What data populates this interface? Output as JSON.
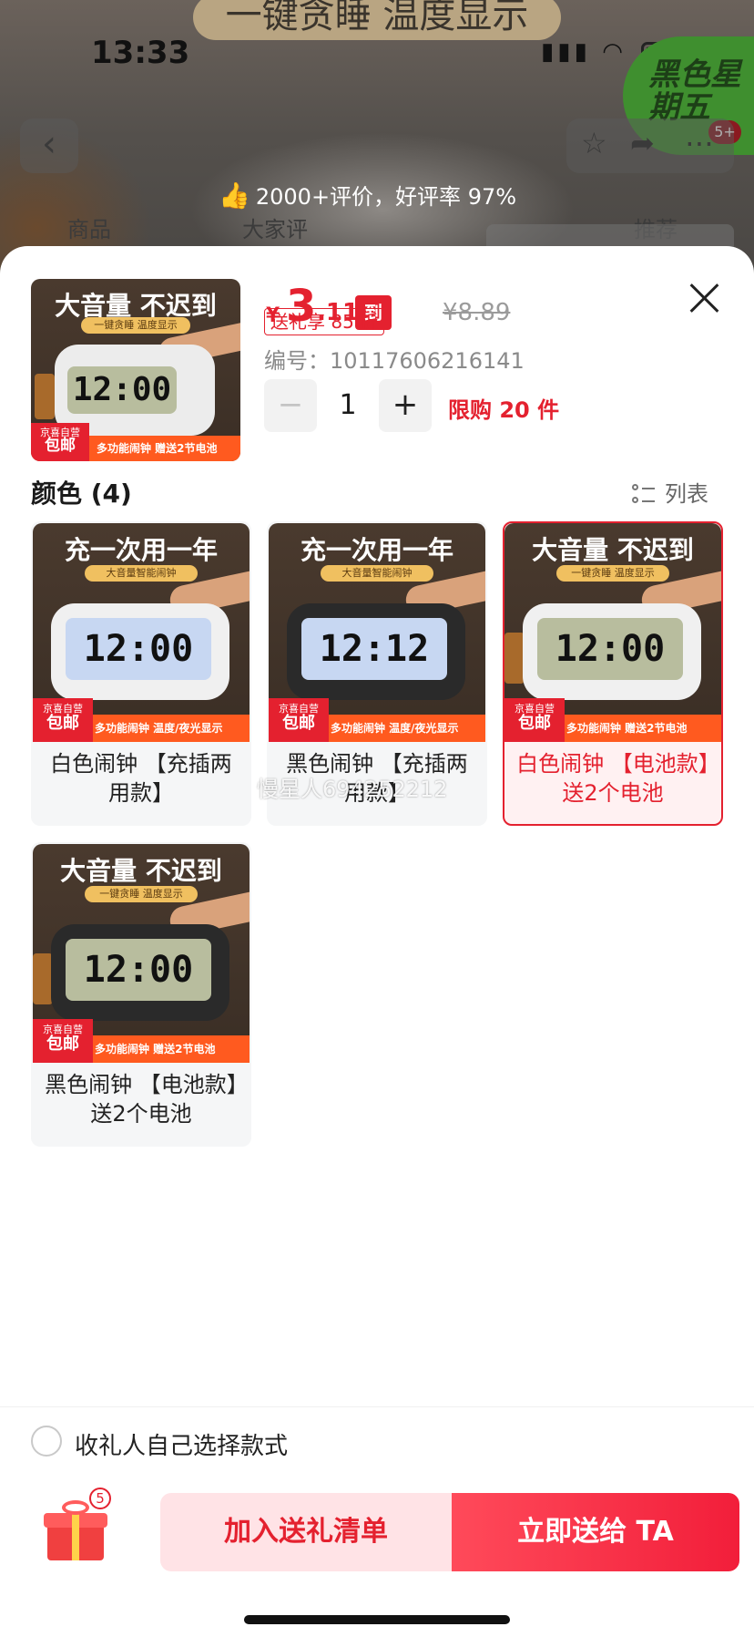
{
  "background_page": {
    "banner_text": "一键贪睡 温度显示",
    "status_time": "13:33",
    "battery_level": "24",
    "promo_badge": "黑色星期五",
    "promo_badge_count": "5+",
    "rating_text": "2000+评价，好评率 97%",
    "tabs": [
      "商品",
      "大家评",
      "推荐"
    ]
  },
  "product": {
    "currency": "¥",
    "price_int": "3",
    "price_dec": ".11",
    "final_price_tag": "到手价",
    "original_price": "¥8.89",
    "discount_tag": "送礼享 85 折",
    "sku_code": "编号：10117606216141",
    "quantity": "1",
    "qty_minus": "−",
    "qty_plus": "+",
    "limit_text": "限购 20 件",
    "thumb": {
      "headline": "大音量 不迟到",
      "subline": "一键贪睡 温度显示",
      "lcd": "12:00",
      "jd_small": "京喜自营",
      "jd_big": "包邮",
      "footer": "多功能闹钟 赠送2节电池"
    }
  },
  "color_section": {
    "title": "颜色 (4)",
    "list_toggle": "列表",
    "options": [
      {
        "label": "白色闹钟 【充插两用款】",
        "headline": "充一次用一年",
        "subline": "大音量智能闹钟",
        "lcd": "12:00",
        "jd_small": "京喜自营",
        "jd_big": "包邮",
        "footer": "多功能闹钟 温度/夜光显示",
        "selected": false
      },
      {
        "label": "黑色闹钟 【充插两用款】",
        "headline": "充一次用一年",
        "subline": "大音量智能闹钟",
        "lcd": "12:12",
        "jd_small": "京喜自营",
        "jd_big": "包邮",
        "footer": "多功能闹钟 温度/夜光显示",
        "selected": false
      },
      {
        "label": "白色闹钟 【电池款】送2个电池",
        "headline": "大音量 不迟到",
        "subline": "一键贪睡 温度显示",
        "lcd": "12:00",
        "jd_small": "京喜自营",
        "jd_big": "包邮",
        "footer": "多功能闹钟 赠送2节电池",
        "selected": true
      },
      {
        "label": "黑色闹钟 【电池款】送2个电池",
        "headline": "大音量 不迟到",
        "subline": "一键贪睡 温度显示",
        "lcd": "12:00",
        "jd_small": "京喜自营",
        "jd_big": "包邮",
        "footer": "多功能闹钟 赠送2节电池",
        "selected": false
      }
    ]
  },
  "watermark": "慢星人694252212",
  "footer": {
    "recipient_choose_label": "收礼人自己选择款式",
    "gift_badge_count": "5",
    "add_to_gift_list": "加入送礼清单",
    "send_now": "立即送给 TA"
  },
  "colors": {
    "accent_red": "#e4212f",
    "selected_bg": "#fff1f2",
    "orange_strip": "#ff5a1f"
  }
}
